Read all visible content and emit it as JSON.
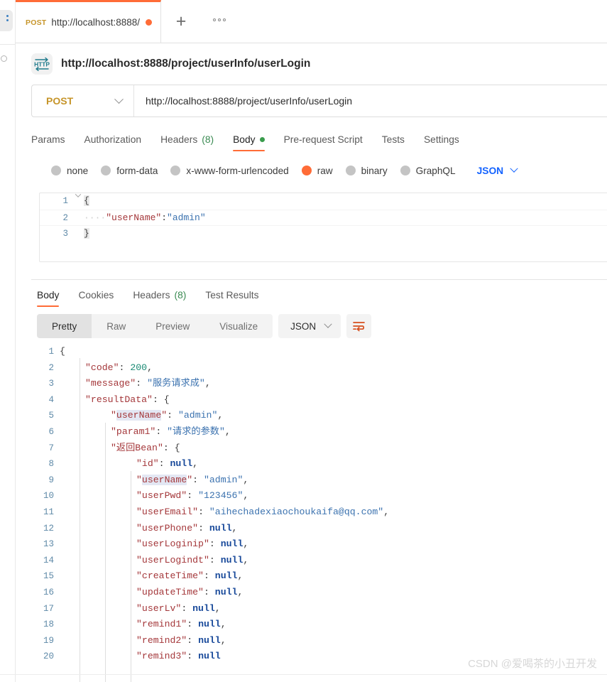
{
  "app": {
    "watermark": "CSDN @爱喝茶的小丑开发"
  },
  "tabstrip": {
    "tab": {
      "method": "POST",
      "name": "http://localhost:8888/",
      "unsaved_color": "#ff6c37"
    },
    "new_tab_label": "+",
    "more_label": "•••"
  },
  "request": {
    "icon": "http-protocol-icon",
    "title": "http://localhost:8888/project/userInfo/userLogin",
    "method": "POST",
    "url": "http://localhost:8888/project/userInfo/userLogin",
    "tabs": [
      {
        "label": "Params",
        "active": false
      },
      {
        "label": "Authorization",
        "active": false
      },
      {
        "label": "Headers",
        "count": "(8)",
        "active": false
      },
      {
        "label": "Body",
        "dot": true,
        "active": true
      },
      {
        "label": "Pre-request Script",
        "active": false
      },
      {
        "label": "Tests",
        "active": false
      },
      {
        "label": "Settings",
        "active": false
      }
    ],
    "body_types": [
      {
        "label": "none",
        "selected": false
      },
      {
        "label": "form-data",
        "selected": false
      },
      {
        "label": "x-www-form-urlencoded",
        "selected": false
      },
      {
        "label": "raw",
        "selected": true
      },
      {
        "label": "binary",
        "selected": false
      },
      {
        "label": "GraphQL",
        "selected": false
      }
    ],
    "format": "JSON",
    "body_lines": [
      {
        "n": "1",
        "fold": true,
        "tokens": [
          {
            "t": "{",
            "c": "p brace-hl"
          }
        ]
      },
      {
        "n": "2",
        "fold": false,
        "tokens": [
          {
            "t": "····",
            "c": "dots"
          },
          {
            "t": "\"userName\"",
            "c": "k"
          },
          {
            "t": ":",
            "c": "p"
          },
          {
            "t": "\"admin\"",
            "c": "s"
          }
        ]
      },
      {
        "n": "3",
        "fold": false,
        "tokens": [
          {
            "t": "}",
            "c": "p brace-hl"
          }
        ]
      }
    ]
  },
  "response": {
    "tabs": [
      {
        "label": "Body",
        "active": true
      },
      {
        "label": "Cookies",
        "active": false
      },
      {
        "label": "Headers",
        "count": "(8)",
        "active": false
      },
      {
        "label": "Test Results",
        "active": false
      }
    ],
    "view_modes": [
      {
        "label": "Pretty",
        "active": true
      },
      {
        "label": "Raw",
        "active": false
      },
      {
        "label": "Preview",
        "active": false
      },
      {
        "label": "Visualize",
        "active": false
      }
    ],
    "format": "JSON",
    "wrap_icon": "wrap-lines-icon",
    "body_lines": [
      {
        "n": "1",
        "indent": 0,
        "tokens": [
          {
            "t": "{",
            "c": "p"
          }
        ]
      },
      {
        "n": "2",
        "indent": 1,
        "tokens": [
          {
            "t": "\"code\"",
            "c": "k"
          },
          {
            "t": ": ",
            "c": "p"
          },
          {
            "t": "200",
            "c": "num"
          },
          {
            "t": ",",
            "c": "p"
          }
        ]
      },
      {
        "n": "3",
        "indent": 1,
        "tokens": [
          {
            "t": "\"message\"",
            "c": "k"
          },
          {
            "t": ": ",
            "c": "p"
          },
          {
            "t": "\"服务请求成\"",
            "c": "s"
          },
          {
            "t": ",",
            "c": "p"
          }
        ]
      },
      {
        "n": "4",
        "indent": 1,
        "tokens": [
          {
            "t": "\"resultData\"",
            "c": "k"
          },
          {
            "t": ": ",
            "c": "p"
          },
          {
            "t": "{",
            "c": "p"
          }
        ]
      },
      {
        "n": "5",
        "indent": 2,
        "tokens": [
          {
            "t": "\"",
            "c": "k"
          },
          {
            "t": "userName",
            "c": "k sel-hl"
          },
          {
            "t": "\"",
            "c": "k"
          },
          {
            "t": ": ",
            "c": "p"
          },
          {
            "t": "\"admin\"",
            "c": "s"
          },
          {
            "t": ",",
            "c": "p"
          }
        ]
      },
      {
        "n": "6",
        "indent": 2,
        "tokens": [
          {
            "t": "\"param1\"",
            "c": "k"
          },
          {
            "t": ": ",
            "c": "p"
          },
          {
            "t": "\"请求的参数\"",
            "c": "s"
          },
          {
            "t": ",",
            "c": "p"
          }
        ]
      },
      {
        "n": "7",
        "indent": 2,
        "tokens": [
          {
            "t": "\"返回Bean\"",
            "c": "k"
          },
          {
            "t": ": ",
            "c": "p"
          },
          {
            "t": "{",
            "c": "p"
          }
        ]
      },
      {
        "n": "8",
        "indent": 3,
        "tokens": [
          {
            "t": "\"id\"",
            "c": "k"
          },
          {
            "t": ": ",
            "c": "p"
          },
          {
            "t": "null",
            "c": "nul"
          },
          {
            "t": ",",
            "c": "p"
          }
        ]
      },
      {
        "n": "9",
        "indent": 3,
        "tokens": [
          {
            "t": "\"",
            "c": "k"
          },
          {
            "t": "userName",
            "c": "k sel-hl"
          },
          {
            "t": "\"",
            "c": "k"
          },
          {
            "t": ": ",
            "c": "p"
          },
          {
            "t": "\"admin\"",
            "c": "s"
          },
          {
            "t": ",",
            "c": "p"
          }
        ]
      },
      {
        "n": "10",
        "indent": 3,
        "tokens": [
          {
            "t": "\"userPwd\"",
            "c": "k"
          },
          {
            "t": ": ",
            "c": "p"
          },
          {
            "t": "\"123456\"",
            "c": "s"
          },
          {
            "t": ",",
            "c": "p"
          }
        ]
      },
      {
        "n": "11",
        "indent": 3,
        "tokens": [
          {
            "t": "\"userEmail\"",
            "c": "k"
          },
          {
            "t": ": ",
            "c": "p"
          },
          {
            "t": "\"aihechadexiaochoukaifa@qq.com\"",
            "c": "s"
          },
          {
            "t": ",",
            "c": "p"
          }
        ]
      },
      {
        "n": "12",
        "indent": 3,
        "tokens": [
          {
            "t": "\"userPhone\"",
            "c": "k"
          },
          {
            "t": ": ",
            "c": "p"
          },
          {
            "t": "null",
            "c": "nul"
          },
          {
            "t": ",",
            "c": "p"
          }
        ]
      },
      {
        "n": "13",
        "indent": 3,
        "tokens": [
          {
            "t": "\"userLoginip\"",
            "c": "k"
          },
          {
            "t": ": ",
            "c": "p"
          },
          {
            "t": "null",
            "c": "nul"
          },
          {
            "t": ",",
            "c": "p"
          }
        ]
      },
      {
        "n": "14",
        "indent": 3,
        "tokens": [
          {
            "t": "\"userLogindt\"",
            "c": "k"
          },
          {
            "t": ": ",
            "c": "p"
          },
          {
            "t": "null",
            "c": "nul"
          },
          {
            "t": ",",
            "c": "p"
          }
        ]
      },
      {
        "n": "15",
        "indent": 3,
        "tokens": [
          {
            "t": "\"createTime\"",
            "c": "k"
          },
          {
            "t": ": ",
            "c": "p"
          },
          {
            "t": "null",
            "c": "nul"
          },
          {
            "t": ",",
            "c": "p"
          }
        ]
      },
      {
        "n": "16",
        "indent": 3,
        "tokens": [
          {
            "t": "\"updateTime\"",
            "c": "k"
          },
          {
            "t": ": ",
            "c": "p"
          },
          {
            "t": "null",
            "c": "nul"
          },
          {
            "t": ",",
            "c": "p"
          }
        ]
      },
      {
        "n": "17",
        "indent": 3,
        "tokens": [
          {
            "t": "\"userLv\"",
            "c": "k"
          },
          {
            "t": ": ",
            "c": "p"
          },
          {
            "t": "null",
            "c": "nul"
          },
          {
            "t": ",",
            "c": "p"
          }
        ]
      },
      {
        "n": "18",
        "indent": 3,
        "tokens": [
          {
            "t": "\"remind1\"",
            "c": "k"
          },
          {
            "t": ": ",
            "c": "p"
          },
          {
            "t": "null",
            "c": "nul"
          },
          {
            "t": ",",
            "c": "p"
          }
        ]
      },
      {
        "n": "19",
        "indent": 3,
        "tokens": [
          {
            "t": "\"remind2\"",
            "c": "k"
          },
          {
            "t": ": ",
            "c": "p"
          },
          {
            "t": "null",
            "c": "nul"
          },
          {
            "t": ",",
            "c": "p"
          }
        ]
      },
      {
        "n": "20",
        "indent": 3,
        "tokens": [
          {
            "t": "\"remind3\"",
            "c": "k"
          },
          {
            "t": ": ",
            "c": "p"
          },
          {
            "t": "null",
            "c": "nul"
          }
        ]
      }
    ]
  }
}
